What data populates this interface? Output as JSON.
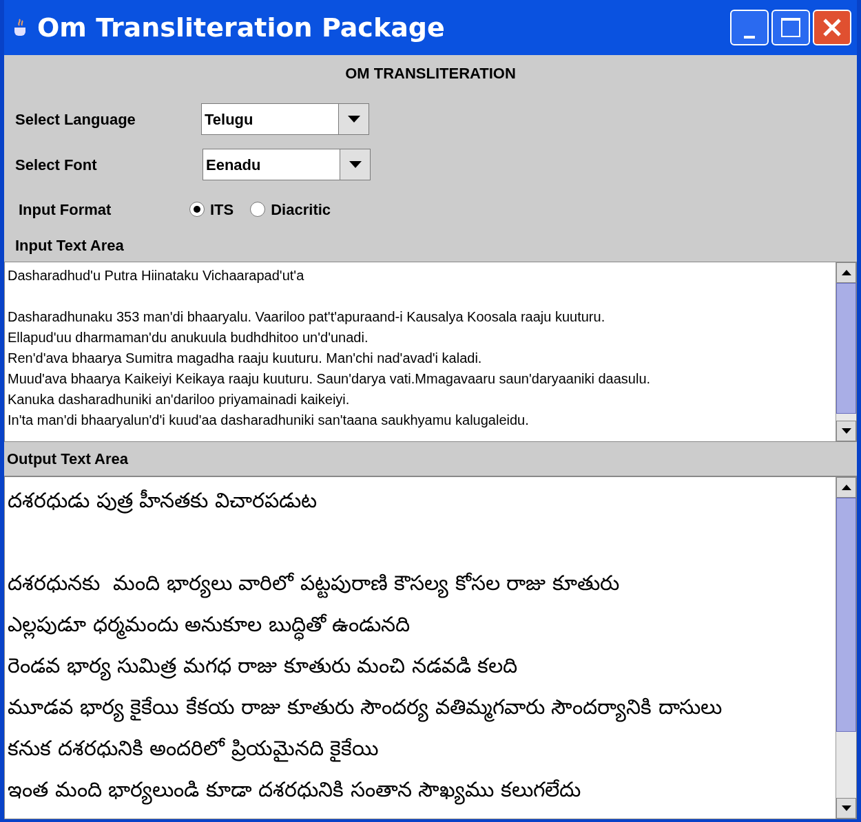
{
  "window": {
    "title": "Om Transliteration Package"
  },
  "heading": "OM TRANSLITERATION",
  "language": {
    "label": "Select Language",
    "value": "Telugu"
  },
  "font": {
    "label": "Select Font",
    "value": "Eenadu"
  },
  "input_format": {
    "label": "Input Format",
    "options": [
      {
        "label": "ITS",
        "selected": true
      },
      {
        "label": "Diacritic",
        "selected": false
      }
    ]
  },
  "input_area": {
    "label": "Input Text Area",
    "first_line": "Dasharadhud'u Putra Hiinataku Vichaarapad'ut'a",
    "lines": [
      "Dasharadhunaku 353 man'di bhaaryalu. Vaariloo pat't'apuraand-i Kausalya Koosala raaju kuuturu.",
      "Ellapud'uu dharmaman'du anukuula budhdhitoo un'd'unadi.",
      "Ren'd'ava bhaarya Sumitra magadha raaju kuuturu. Man'chi nad'avad'i kaladi.",
      "Muud'ava bhaarya Kaikeiyi Keikaya raaju kuuturu. Saun'darya vati.Mmagavaaru saun'daryaaniki daasulu.",
      "Kanuka dasharadhuniki an'dariloo priyamainadi kaikeiyi.",
      "In'ta man'di bhaaryalun'd'i kuud'aa dasharadhuniki san'taana saukhyamu kalugaleidu."
    ]
  },
  "output_area": {
    "label": "Output Text Area",
    "first_line": "దశరధుడు పుత్ర హీనతకు విచారపడుట",
    "lines": [
      "దశరధునకు  మంది భార్యలు వారిలో పట్టపురాణి కౌసల్య కోసల రాజు కూతురు",
      "ఎల్లపుడూ ధర్మమందు అనుకూల బుద్ధితో ఉండునది",
      "రెండవ భార్య సుమిత్ర మగధ రాజు కూతురు మంచి నడవడి కలది",
      "మూడవ భార్య కైకేయి కేకయ రాజు కూతురు సౌందర్య వతిమ్మగవారు సౌందర్యానికి దాసులు",
      "కనుక దశరధునికి అందరిలో ప్రియమైనది కైకేయి",
      "ఇంత మంది భార్యలుండి కూడా దశరధునికి సంతాన సౌఖ్యము కలుగలేదు"
    ]
  }
}
